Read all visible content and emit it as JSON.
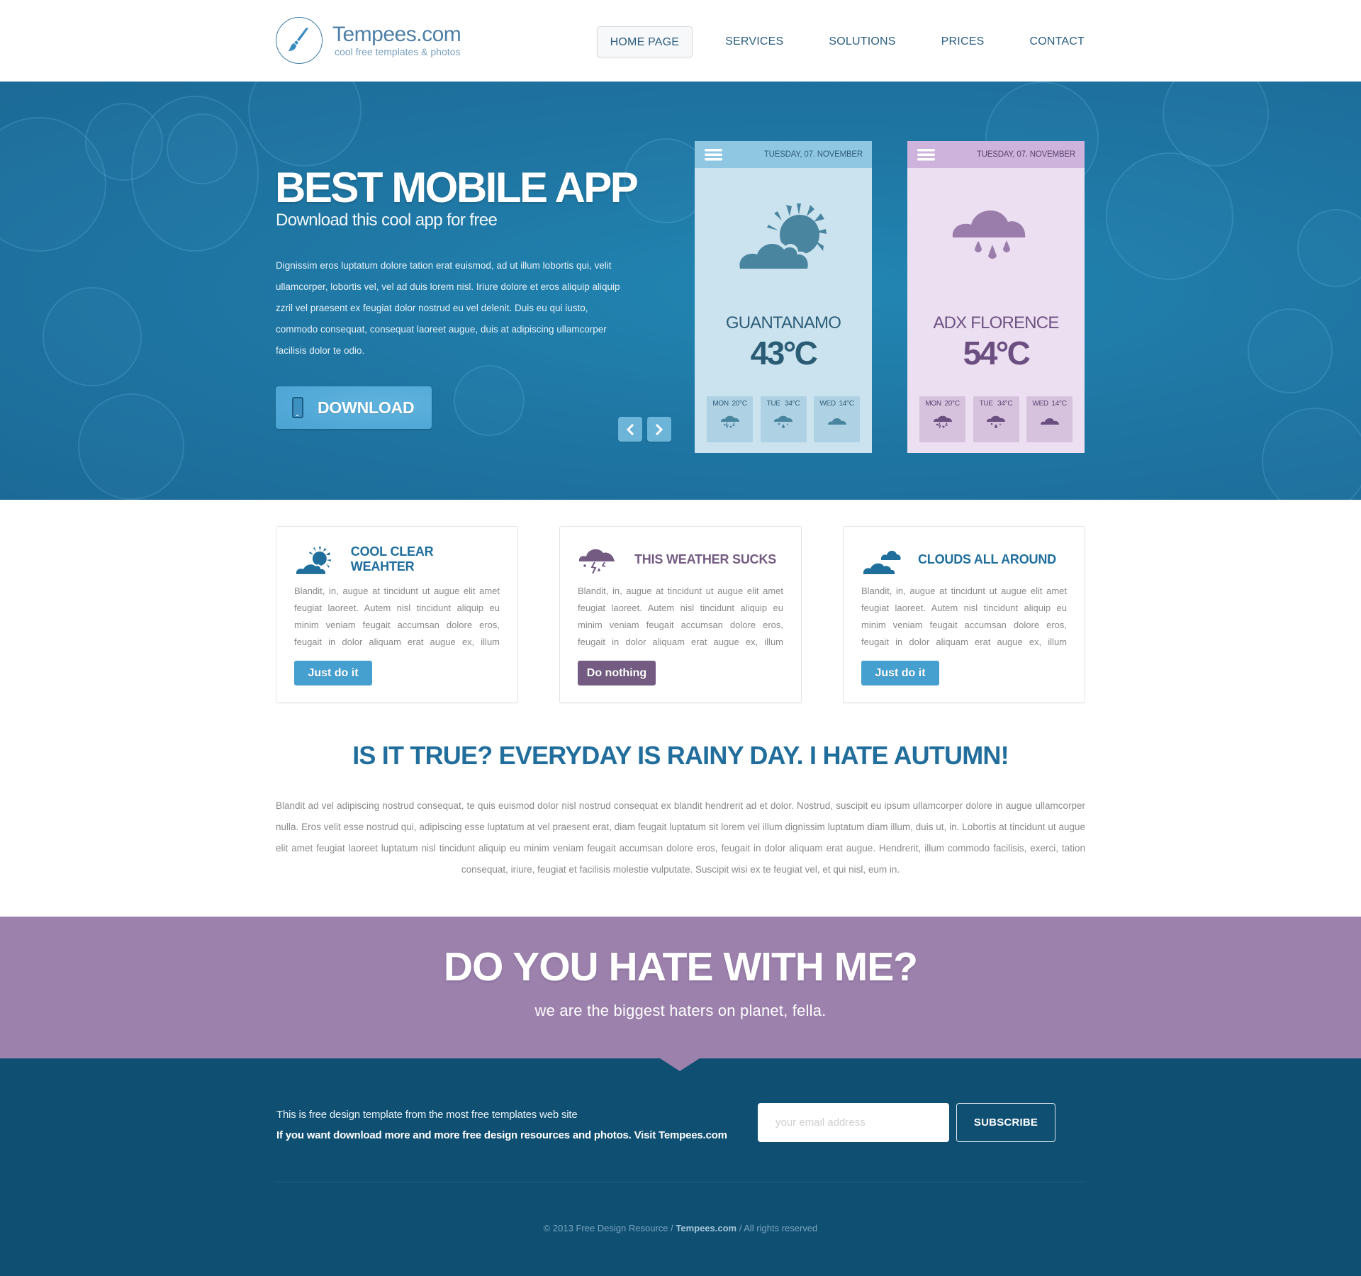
{
  "header": {
    "logo_title": "Tempees.com",
    "logo_subtitle": "cool free templates & photos",
    "nav": [
      {
        "label": "HOME PAGE",
        "active": true
      },
      {
        "label": "SERVICES",
        "active": false
      },
      {
        "label": "SOLUTIONS",
        "active": false
      },
      {
        "label": "PRICES",
        "active": false
      },
      {
        "label": "CONTACT",
        "active": false
      }
    ]
  },
  "hero": {
    "title": "BEST MOBILE APP",
    "subtitle": "Download this cool app for free",
    "body": "Dignissim eros luptatum dolore tation erat euismod, ad ut illum lobortis qui, velit ullamcorper, lobortis vel, vel ad duis lorem nisl. Iriure dolore et eros aliquip aliquip zzril vel praesent ex feugiat dolor nostrud eu vel delenit. Duis eu qui iusto, commodo consequat, consequat laoreet augue, duis at adipiscing ullamcorper facilisis dolor te odio.",
    "download_label": "DOWNLOAD",
    "prev_icon": "chevron-left-icon",
    "next_icon": "chevron-right-icon"
  },
  "phones": [
    {
      "date": "TUESDAY, 07. NOVEMBER",
      "main_icon": "partly-sunny-icon",
      "city": "GUANTANAMO",
      "temp": "43°C",
      "forecast": [
        {
          "day": "MON",
          "temp": "20°C",
          "icon": "storm-icon"
        },
        {
          "day": "TUE",
          "temp": "34°C",
          "icon": "rain-icon"
        },
        {
          "day": "WED",
          "temp": "14°C",
          "icon": "cloud-icon"
        }
      ]
    },
    {
      "date": "TUESDAY, 07. NOVEMBER",
      "main_icon": "rain-cloud-icon",
      "city": "ADX FLORENCE",
      "temp": "54°C",
      "forecast": [
        {
          "day": "MON",
          "temp": "20°C",
          "icon": "storm-icon"
        },
        {
          "day": "TUE",
          "temp": "34°C",
          "icon": "rain-icon"
        },
        {
          "day": "WED",
          "temp": "14°C",
          "icon": "cloud-icon"
        }
      ]
    }
  ],
  "features": [
    {
      "title": "COOL CLEAR WEAHTER",
      "icon": "partly-sunny-icon",
      "body": "Blandit, in, augue at tincidunt ut augue elit amet feugiat laoreet. Autem nisl tincidunt aliquip eu minim veniam feugait accumsan dolore eros, feugait in dolor aliquam erat augue ex, illum",
      "button": "Just do it"
    },
    {
      "title": "THIS WEATHER SUCKS",
      "icon": "storm-cloud-icon",
      "body": "Blandit, in, augue at tincidunt ut augue elit amet feugiat laoreet. Autem nisl tincidunt aliquip eu minim veniam feugait accumsan dolore eros, feugait in dolor aliquam erat augue ex, illum",
      "button": "Do nothing"
    },
    {
      "title": "CLOUDS ALL AROUND",
      "icon": "clouds-icon",
      "body": "Blandit, in, augue at tincidunt ut augue elit amet feugiat laoreet. Autem nisl tincidunt aliquip eu minim veniam feugait accumsan dolore eros, feugait in dolor aliquam erat augue ex, illum",
      "button": "Just do it"
    }
  ],
  "about": {
    "title": "IS IT TRUE? EVERYDAY IS RAINY DAY. I HATE AUTUMN!",
    "body": "Blandit ad vel adipiscing nostrud consequat, te quis euismod dolor nisl nostrud consequat ex blandit hendrerit ad et dolor. Nostrud, suscipit eu ipsum ullamcorper dolore in augue ullamcorper nulla. Eros velit esse nostrud qui, adipiscing esse luptatum at vel praesent erat, diam feugait luptatum sit lorem vel illum dignissim luptatum diam illum, duis ut, in. Lobortis at tincidunt ut augue elit amet feugiat laoreet luptatum nisl tincidunt aliquip eu minim veniam feugait accumsan dolore eros, feugait in dolor aliquam erat augue. Hendrerit, illum commodo facilisis, exerci, tation consequat, iriure, feugiat et facilisis molestie vulputate. Suscipit wisi ex te feugiat vel, et qui nisl, eum in."
  },
  "cta": {
    "title": "DO YOU HATE WITH ME?",
    "subtitle": "we are the biggest haters on planet, fella."
  },
  "footer": {
    "info_line1": "This is free design template from the most free templates web site",
    "info_line2": "If you want download more and more free design resources and photos. Visit Tempees.com",
    "email_placeholder": "your email address",
    "email_value": "",
    "subscribe_label": "SUBSCRIBE",
    "copyright_prefix": "© 2013 Free Design Resource / ",
    "copyright_brand": "Tempees.com",
    "copyright_suffix": " / All rights reserved"
  },
  "colors": {
    "brand_blue": "#1f6e9c",
    "hero_blue": "#1f77a4",
    "button_blue": "#45a0cf",
    "brand_purple": "#735b82",
    "cta_purple": "#9c81ad",
    "footer_navy": "#0f4f72"
  }
}
